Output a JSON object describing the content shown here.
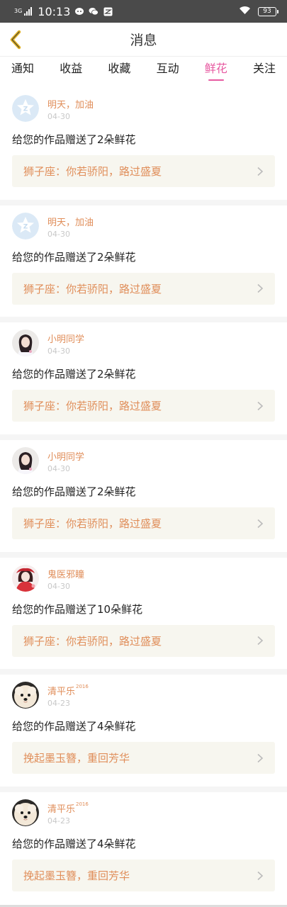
{
  "status_bar": {
    "network_label": "3G",
    "time": "10:13",
    "battery": "93"
  },
  "nav": {
    "title": "消息"
  },
  "tabs": [
    {
      "label": "通知",
      "active": false
    },
    {
      "label": "收益",
      "active": false
    },
    {
      "label": "收藏",
      "active": false
    },
    {
      "label": "互动",
      "active": false
    },
    {
      "label": "鲜花",
      "active": true
    },
    {
      "label": "关注",
      "active": false
    }
  ],
  "messages": [
    {
      "name": "明天，加油",
      "sup": "",
      "date": "04-30",
      "text": "给您的作品赠送了2朵鲜花",
      "work": "狮子座：你若骄阳，路过盛夏",
      "avatar": "default"
    },
    {
      "name": "明天，加油",
      "sup": "",
      "date": "04-30",
      "text": "给您的作品赠送了2朵鲜花",
      "work": "狮子座：你若骄阳，路过盛夏",
      "avatar": "default"
    },
    {
      "name": "小明同学",
      "sup": "",
      "date": "04-30",
      "text": "给您的作品赠送了2朵鲜花",
      "work": "狮子座：你若骄阳，路过盛夏",
      "avatar": "girl"
    },
    {
      "name": "小明同学",
      "sup": "",
      "date": "04-30",
      "text": "给您的作品赠送了2朵鲜花",
      "work": "狮子座：你若骄阳，路过盛夏",
      "avatar": "girl"
    },
    {
      "name": "鬼医邪瞳",
      "sup": "",
      "date": "04-30",
      "text": "给您的作品赠送了10朵鲜花",
      "work": "狮子座：你若骄阳，路过盛夏",
      "avatar": "red"
    },
    {
      "name": "清平乐",
      "sup": "2016",
      "date": "04-23",
      "text": "给您的作品赠送了4朵鲜花",
      "work": "挽起墨玉簪，重回芳华",
      "avatar": "dog"
    },
    {
      "name": "清平乐",
      "sup": "2016",
      "date": "04-23",
      "text": "给您的作品赠送了4朵鲜花",
      "work": "挽起墨玉簪，重回芳华",
      "avatar": "dog"
    }
  ],
  "colors": {
    "accent_pink": "#e75aa1",
    "name_orange": "#e08e5a",
    "work_bg": "#f7f6ef",
    "back_icon": "#e0b020"
  }
}
